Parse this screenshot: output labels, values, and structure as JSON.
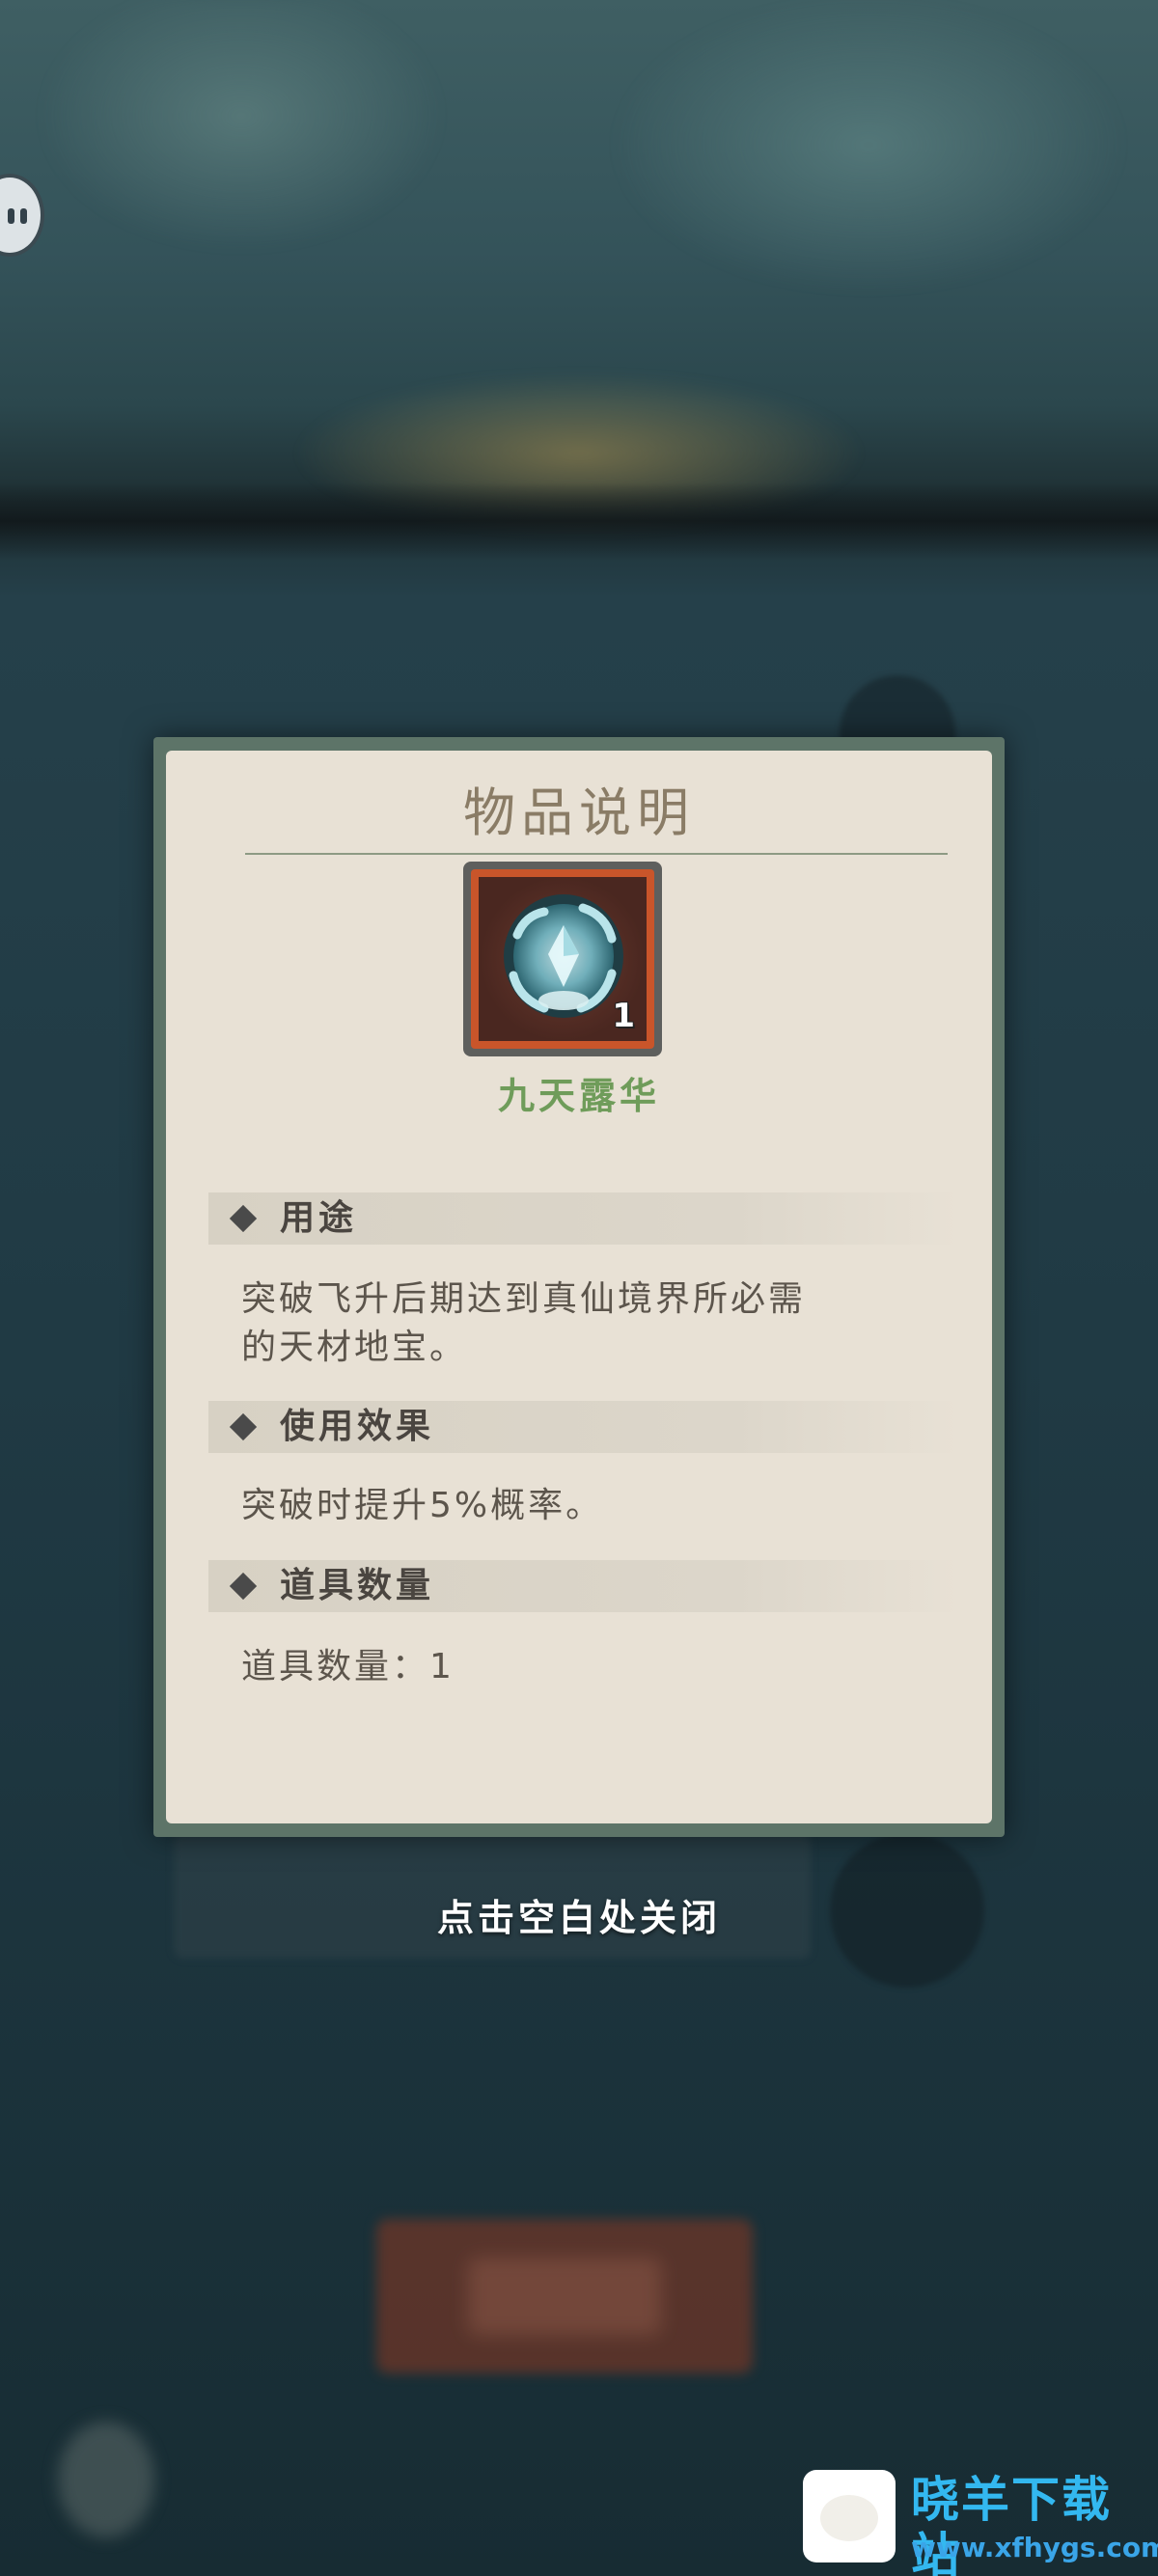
{
  "dialog": {
    "title": "物品说明",
    "item": {
      "name": "九天露华",
      "count": "1",
      "icon": "crystal-orb-icon"
    },
    "sections": [
      {
        "label": "用途",
        "text_lines": [
          "突破飞升后期达到真仙境界所必需",
          "的天材地宝。"
        ]
      },
      {
        "label": "使用效果",
        "text_lines": [
          "突破时提升5%概率。"
        ]
      },
      {
        "label": "道具数量",
        "text_lines": [
          "道具数量：1"
        ]
      }
    ]
  },
  "close_hint": "点击空白处关闭",
  "watermark": {
    "title": "晓羊下载站",
    "url": "www.xfhygs.com"
  },
  "colors": {
    "panel_bg": "#e8e1d5",
    "panel_border": "#5d7468",
    "item_name": "#6f9c5a",
    "icon_frame": "#c9552a",
    "watermark_blue": "#33b8f0"
  }
}
